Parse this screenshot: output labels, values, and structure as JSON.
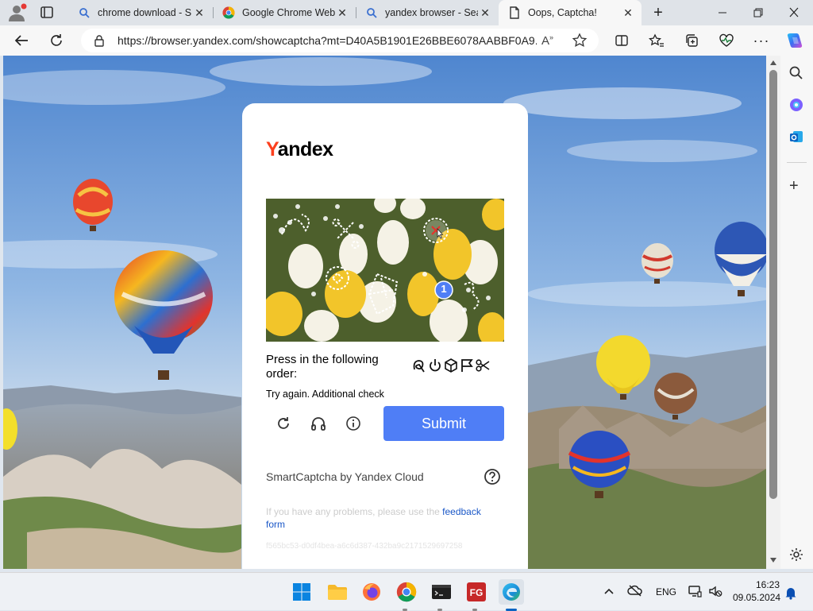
{
  "browser": {
    "tabs": [
      {
        "title": "chrome download - S",
        "icon": "search-icon",
        "active": false
      },
      {
        "title": "Google Chrome Web",
        "icon": "chrome-icon",
        "active": false
      },
      {
        "title": "yandex browser - Sea",
        "icon": "search-icon",
        "active": false
      },
      {
        "title": "Oops, Captcha!",
        "icon": "page-icon",
        "active": true
      }
    ],
    "address": "https://browser.yandex.com/showcaptcha?mt=D40A5B1901E26BBE6078AABBF0A9..."
  },
  "captcha": {
    "logo": {
      "first": "Y",
      "rest": "andex"
    },
    "marker_number": "1",
    "instruction": "Press in the following order:",
    "sequence_icons": [
      "knot-icon",
      "power-icon",
      "cube-icon",
      "flag-icon",
      "scissors-icon"
    ],
    "try_again": "Try again. Additional check",
    "submit_label": "Submit",
    "smartcaptcha_label": "SmartCaptcha by Yandex Cloud",
    "feedback_prefix": "If you have any problems, please use the",
    "feedback_link": "feedback form",
    "request_id": "f565bc53-d0df4bea-a6c6d387-432ba9c2171529697258"
  },
  "taskbar": {
    "language": "ENG",
    "time": "16:23",
    "date": "09.05.2024"
  },
  "colors": {
    "accent": "#4f7ef6",
    "yandex_red": "#fc3f1d",
    "link": "#1a57c7"
  }
}
